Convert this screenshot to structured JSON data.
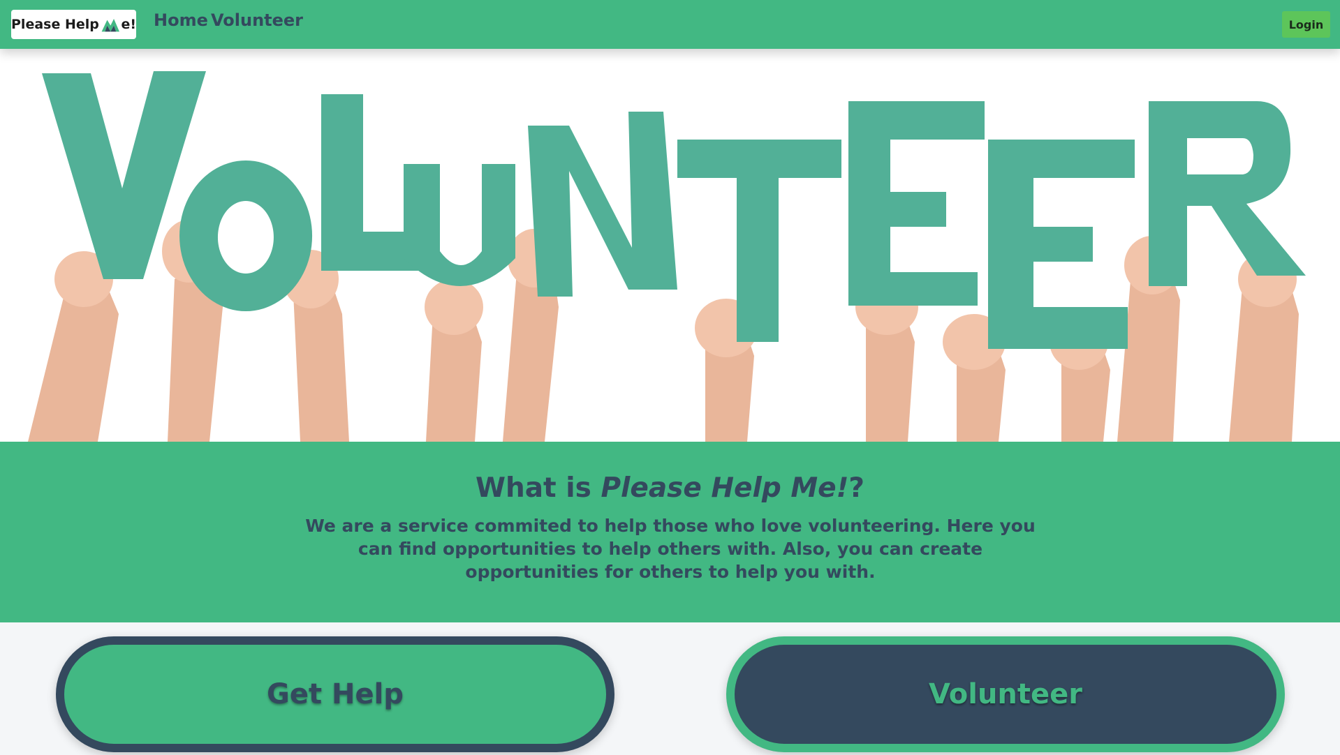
{
  "navbar": {
    "brand": {
      "prefix": "Please Help ",
      "logo_icon": "m-mountain-logo-icon",
      "suffix": "e!"
    },
    "links": {
      "home": "Home",
      "volunteer": "Volunteer"
    },
    "login": "Login"
  },
  "hero": {
    "image": "volunteer-letters-held-by-hands",
    "letters": [
      "V",
      "O",
      "L",
      "U",
      "N",
      "T",
      "E",
      "E",
      "R"
    ]
  },
  "about": {
    "title_prefix": "What is ",
    "title_brand": "Please Help Me!",
    "title_suffix": "?",
    "text": "We are a service commited to help those who love volunteering. Here you can find opportunities to help others with. Also, you can create opportunities for others to help you with."
  },
  "actions": {
    "get_help": "Get Help",
    "volunteer": "Volunteer"
  },
  "colors": {
    "primary_green": "#42b883",
    "dark_slate": "#34495e",
    "letter_teal": "#52b097",
    "login_green": "#5dc55a"
  }
}
